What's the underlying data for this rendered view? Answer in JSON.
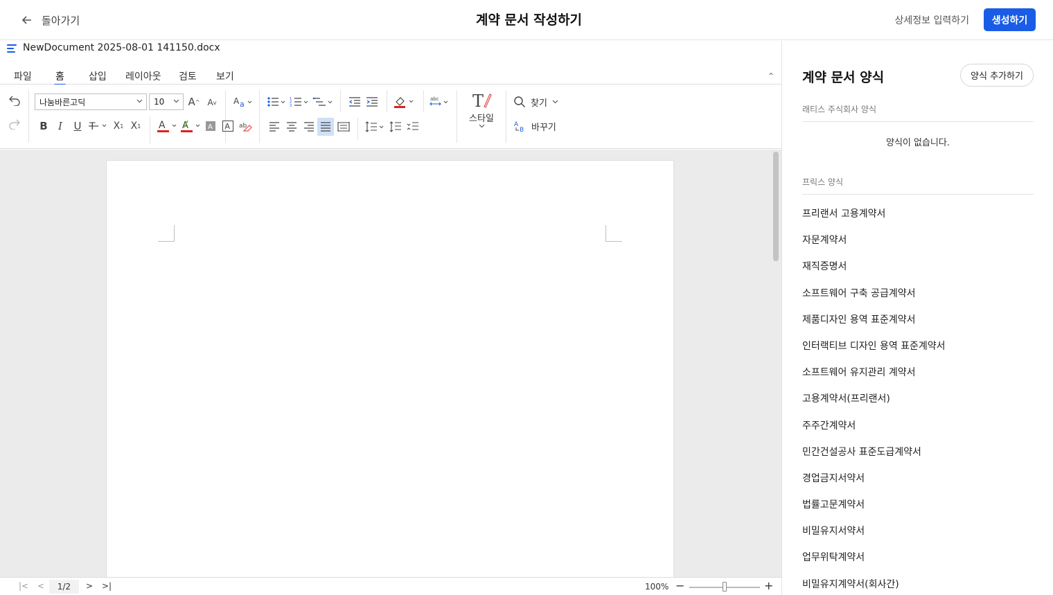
{
  "header": {
    "back_label": "돌아가기",
    "title": "계약 문서 작성하기",
    "detail_link": "상세정보 입력하기",
    "create_label": "생성하기"
  },
  "document": {
    "filename": "NewDocument 2025-08-01 141150.docx"
  },
  "tabs": [
    {
      "label": "파일"
    },
    {
      "label": "홈"
    },
    {
      "label": "삽입"
    },
    {
      "label": "레이아웃"
    },
    {
      "label": "검토"
    },
    {
      "label": "보기"
    }
  ],
  "toolbar": {
    "font_family": "나눔바른고딕",
    "font_size": "10",
    "style_label": "스타일",
    "find_label": "찾기",
    "replace_label": "바꾸기"
  },
  "statusbar": {
    "page_indicator": "1/2",
    "zoom": "100%"
  },
  "zoom_level": 0.5,
  "panel": {
    "title": "계약 문서 양식",
    "add_button": "양식 추가하기",
    "company_section": "래티스 주식회사 양식",
    "empty_message": "양식이 없습니다.",
    "prix_section": "프릭스 양식",
    "templates": [
      "프리랜서 고용계약서",
      "자문계약서",
      "재직증명서",
      "소프트웨어 구축 공급계약서",
      "제품디자인 용역 표준계약서",
      "인터랙티브 디자인 용역 표준계약서",
      "소프트웨어 유지관리 계약서",
      "고용계약서(프리랜서)",
      "주주간계약서",
      "민간건설공사 표준도급계약서",
      "경업금지서약서",
      "법률고문계약서",
      "비밀유지서약서",
      "업무위탁계약서",
      "비밀유지계약서(회사간)"
    ]
  },
  "colors": {
    "accent": "#1a5ce6",
    "font_color_underline": "#e02020",
    "canvas_bg": "#ebebeb"
  }
}
